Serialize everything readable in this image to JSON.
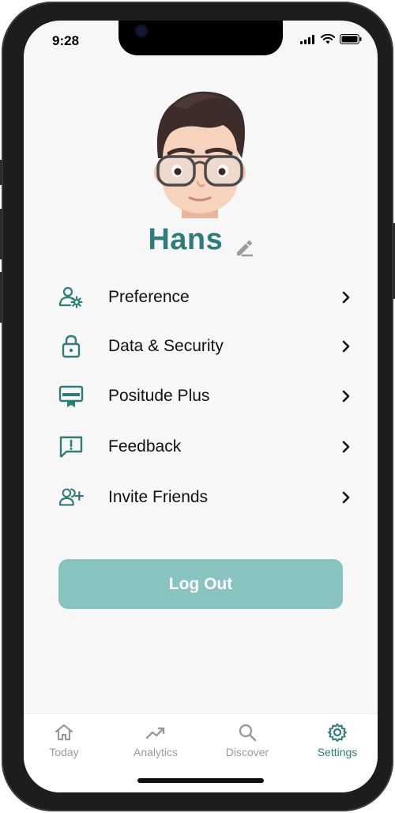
{
  "status_bar": {
    "time": "9:28"
  },
  "profile": {
    "name": "Hans"
  },
  "menu": [
    {
      "label": "Preference",
      "icon": "user-gear-icon"
    },
    {
      "label": "Data & Security",
      "icon": "lock-icon"
    },
    {
      "label": "Positude Plus",
      "icon": "certificate-icon"
    },
    {
      "label": "Feedback",
      "icon": "feedback-icon"
    },
    {
      "label": "Invite Friends",
      "icon": "add-friends-icon"
    }
  ],
  "logout_label": "Log Out",
  "tabs": [
    {
      "label": "Today",
      "icon": "home-icon"
    },
    {
      "label": "Analytics",
      "icon": "trend-icon"
    },
    {
      "label": "Discover",
      "icon": "search-icon"
    },
    {
      "label": "Settings",
      "icon": "gear-icon",
      "active": true
    }
  ],
  "colors": {
    "accent": "#2e7d7a",
    "button": "#88c3bf",
    "background": "#f7f7f7",
    "inactive": "#9a9a9a"
  }
}
